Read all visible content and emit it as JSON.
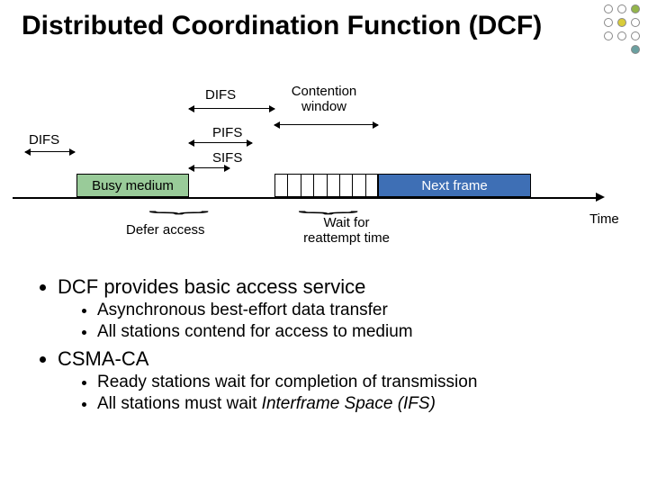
{
  "title": "Distributed Coordination Function (DCF)",
  "diagram": {
    "labels": {
      "difs_top": "DIFS",
      "contention_window": "Contention\nwindow",
      "difs_left": "DIFS",
      "pifs": "PIFS",
      "sifs": "SIFS",
      "busy_medium": "Busy medium",
      "next_frame": "Next frame",
      "defer_access": "Defer access",
      "wait_reattempt": "Wait for\nreattempt time",
      "time": "Time"
    },
    "contention_slots": 8
  },
  "bullets": {
    "b1": "DCF provides basic access service",
    "b1_1": "Asynchronous best-effort data transfer",
    "b1_2": "All stations contend for access to medium",
    "b2": "CSMA-CA",
    "b2_1": "Ready stations wait for completion of transmission",
    "b2_2_pre": "All stations must wait ",
    "b2_2_em": "Interframe Space (IFS)"
  },
  "colors": {
    "busy_fill": "#99cb99",
    "next_fill": "#3e6fb5"
  }
}
